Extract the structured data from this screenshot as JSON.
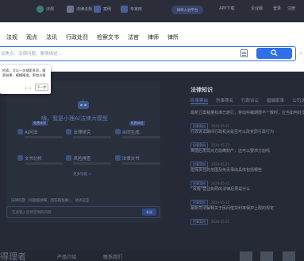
{
  "topbar": {
    "items": [
      {
        "label": "法规",
        "icon": "green-circle-icon"
      },
      {
        "label": "法律法规",
        "icon": "book-icon"
      },
      {
        "label": "案例",
        "icon": "case-icon"
      },
      {
        "label": "专家库",
        "icon": "expert-icon"
      }
    ],
    "pill": "律师入驻平台",
    "right_items": [
      "APP下载",
      "企业版",
      "登录",
      "注册"
    ]
  },
  "nav": {
    "items": [
      "法规",
      "观点",
      "法讯",
      "行政处罚",
      "检察文书",
      "法官",
      "律师",
      "律所"
    ]
  },
  "search": {
    "placeholder": "议焦点、法律问题、案情描述..."
  },
  "tooltip": {
    "text": "检索，可以一次搜索多项，搜索结果，模糊精准，更加方便",
    "step": "1 / 2",
    "next": "下一步"
  },
  "assistant": {
    "title": "嗨，我是小理AI法律大模型",
    "tools": [
      {
        "name": "AI问法",
        "badge": "免费体验"
      },
      {
        "name": "法律研究",
        "badge": ""
      },
      {
        "name": "合同生成",
        "badge": "免费体验"
      },
      {
        "name": "文书分析",
        "badge": ""
      },
      {
        "name": "风险排查",
        "badge": ""
      },
      {
        "name": "法律文书",
        "badge": ""
      }
    ],
    "more": "更多功能 >",
    "chat_hint": "法律问题（问题越详细，回答越准确），  试试这些",
    "chat_placeholder": "在此输入您想咨询的问题",
    "send_label": "发送"
  },
  "knowledge": {
    "title": "法律知识",
    "categories": [
      "民事案由",
      "刑事罪名",
      "行政诉讼",
      "婚姻家事",
      "公司法"
    ],
    "articles": [
      {
        "title": "最新立案裁量标准已施行，劳动仲裁期限不一致时，应当如何处理",
        "tag": "民事案由",
        "time": "2024-05-21"
      },
      {
        "title": "行政诉讼期间行政机关是否可以改变原行政行为",
        "tag": "民事案由",
        "time": "2024-05-21"
      },
      {
        "title": "离婚后发现对方隐瞒财产，还可以要求分割吗",
        "tag": "民事案由",
        "time": "2024-05-21"
      },
      {
        "title": "担保责任的范围及免责事由具体包括哪些",
        "tag": "民事案由",
        "time": "2024-05-21"
      },
      {
        "title": "“吊销”营业执照的法律后果是什么",
        "tag": "民事案由",
        "time": "2024-05-21"
      },
      {
        "title": "最新司法解释关于民间借贷利率保护上限的规定",
        "tag": "民事案由",
        "time": "2024-05-21"
      }
    ]
  },
  "footer": {
    "logo": "得理者",
    "links": [
      "产品介绍",
      "联系我们"
    ]
  }
}
